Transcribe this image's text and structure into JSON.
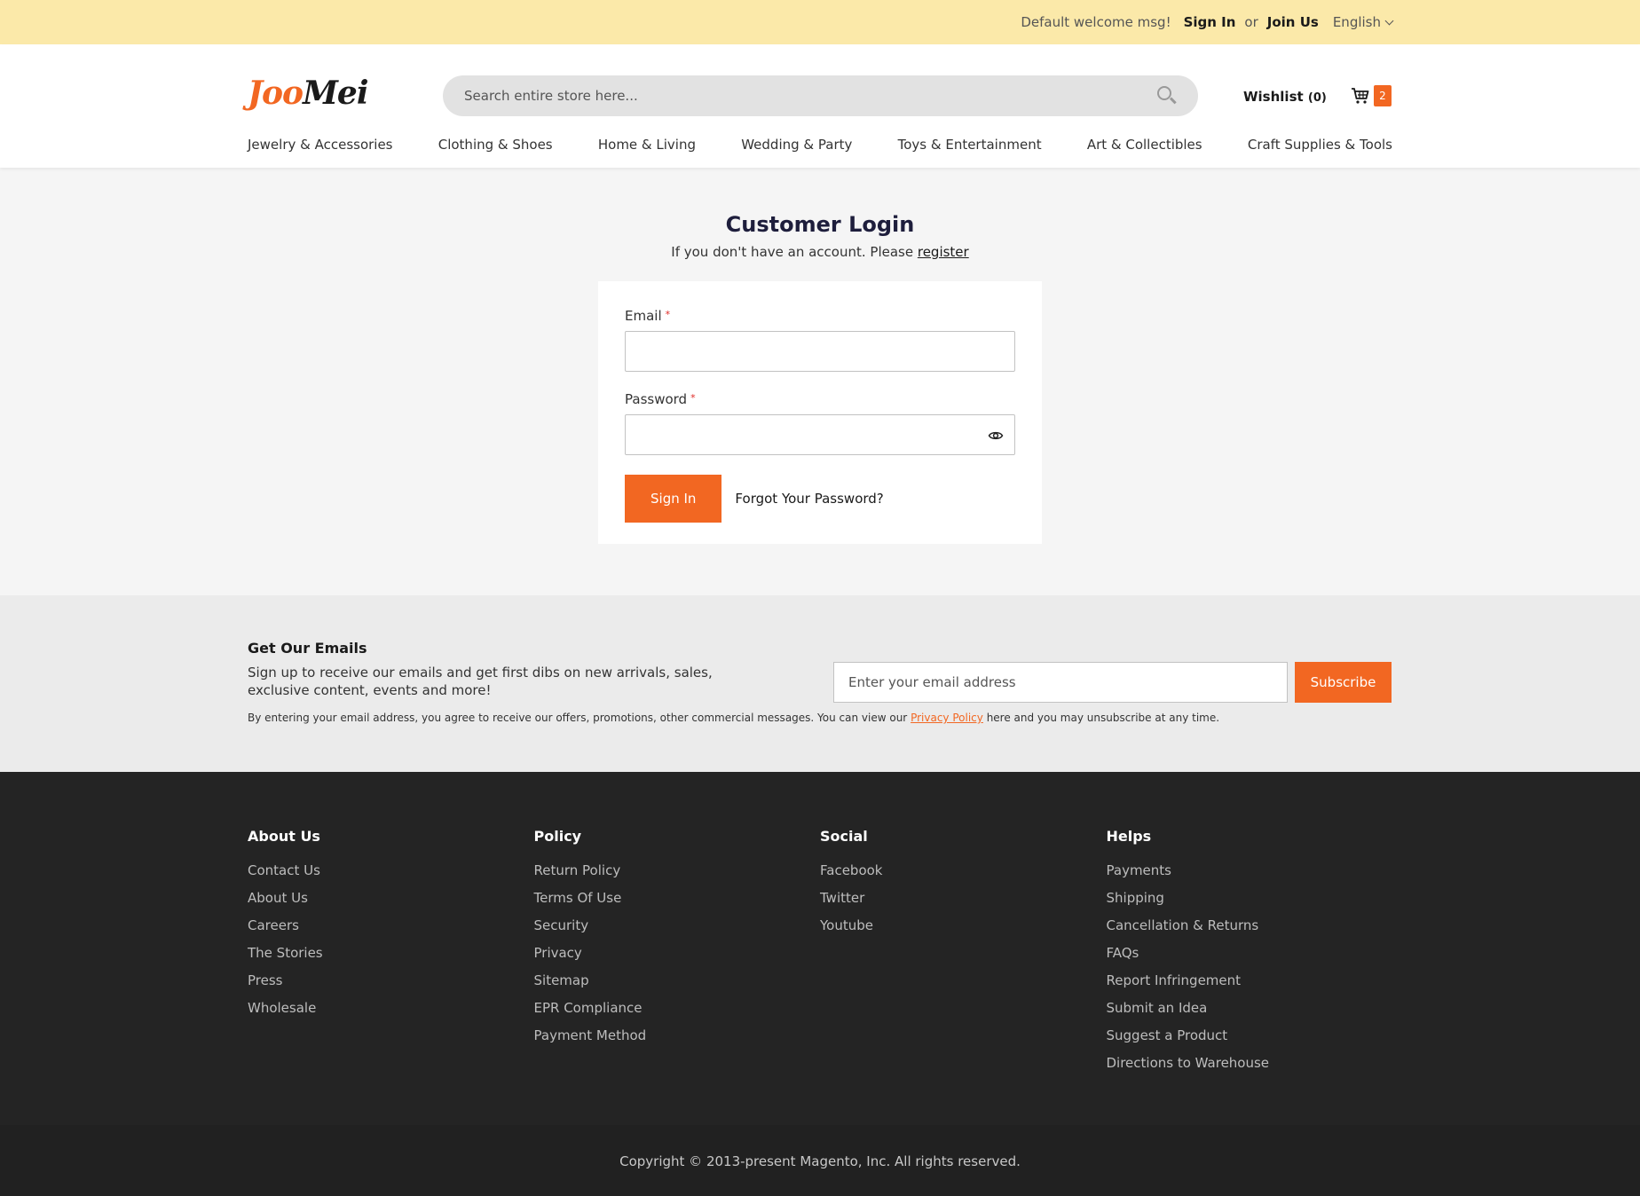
{
  "topbar": {
    "welcome": "Default welcome msg!",
    "sign_in": "Sign In",
    "or": "or",
    "join": "Join Us",
    "language": "English"
  },
  "header": {
    "logo_part1": "Joo",
    "logo_part2": "Mei",
    "search_placeholder": "Search entire store here...",
    "wishlist_label": "Wishlist",
    "wishlist_count": "(0)",
    "cart_count": "2"
  },
  "nav": [
    "Jewelry & Accessories",
    "Clothing & Shoes",
    "Home & Living",
    "Wedding & Party",
    "Toys & Entertainment",
    "Art & Collectibles",
    "Craft Supplies & Tools"
  ],
  "login": {
    "title": "Customer Login",
    "subtitle": "If you don't have an account. Please",
    "register_link": "register",
    "email_label": "Email",
    "password_label": "Password",
    "required_mark": "*",
    "sign_in_button": "Sign In",
    "forgot_link": "Forgot Your Password?"
  },
  "newsletter": {
    "title": "Get Our Emails",
    "description": "Sign up to receive our emails and get first dibs on new arrivals, sales, exclusive content, events and more!",
    "input_placeholder": "Enter your email address",
    "button": "Subscribe",
    "note_before": "By entering your email address, you agree to receive our offers, promotions, other commercial messages. You can view our",
    "note_link": "Privacy Policy",
    "note_after": "here and you may unsubscribe at any time."
  },
  "footer": {
    "columns": [
      {
        "title": "About Us",
        "links": [
          "Contact Us",
          "About Us",
          "Careers",
          "The Stories",
          "Press",
          "Wholesale"
        ]
      },
      {
        "title": "Policy",
        "links": [
          "Return Policy",
          "Terms Of Use",
          "Security",
          "Privacy",
          "Sitemap",
          "EPR Compliance",
          "Payment Method"
        ]
      },
      {
        "title": "Social",
        "links": [
          "Facebook",
          "Twitter",
          "Youtube"
        ]
      },
      {
        "title": "Helps",
        "links": [
          "Payments",
          "Shipping",
          "Cancellation & Returns",
          "FAQs",
          "Report Infringement",
          "Submit an Idea",
          "Suggest a Product",
          "Directions to Warehouse"
        ]
      }
    ],
    "copyright": "Copyright © 2013-present Magento, Inc. All rights reserved."
  },
  "colors": {
    "accent": "#f26722",
    "topbar_bg": "#fbe9a9",
    "footer_bg": "#242424"
  }
}
